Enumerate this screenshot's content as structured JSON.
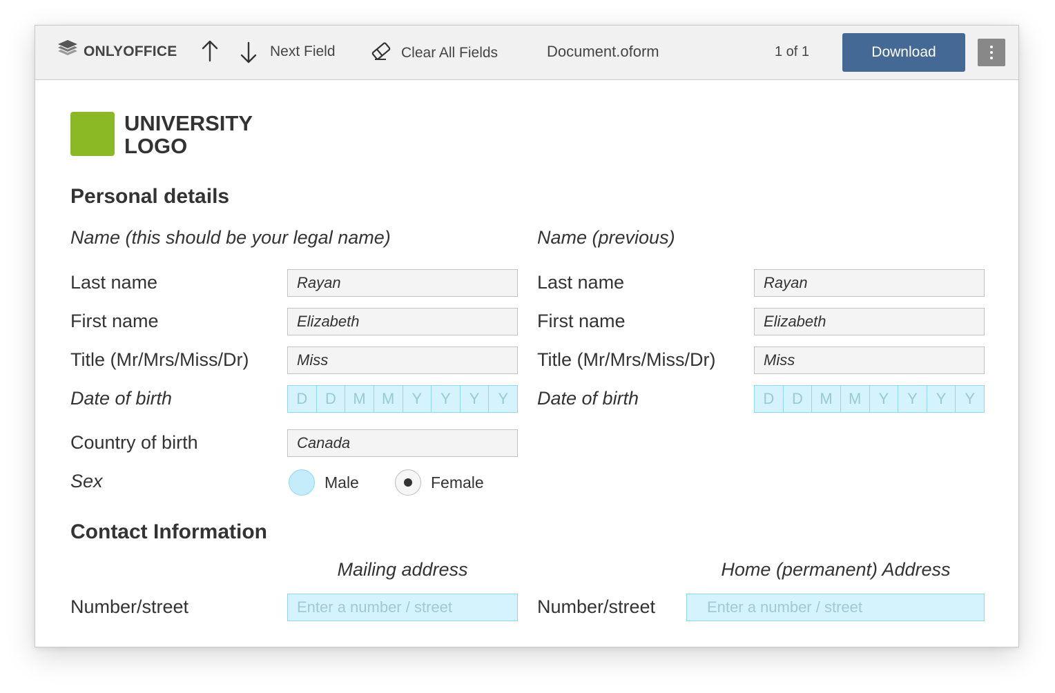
{
  "toolbar": {
    "logo_text": "ONLYOFFICE",
    "next_field_label": "Next Field",
    "clear_all_label": "Clear All Fields",
    "document_name": "Document.oform",
    "page_indicator": "1 of 1",
    "download_label": "Download"
  },
  "document": {
    "university_logo": {
      "line1": "UNIVERSITY",
      "line2": "LOGO"
    },
    "personal_details": {
      "heading": "Personal details",
      "legal_name_heading": "Name (this should be your legal name)",
      "previous_name_heading": "Name (previous)",
      "labels": {
        "last_name": "Last name",
        "first_name": "First name",
        "title": "Title (Mr/Mrs/Miss/Dr)",
        "date_of_birth": "Date of birth",
        "country_of_birth": "Country of birth",
        "sex": "Sex"
      },
      "legal": {
        "last_name": "Rayan",
        "first_name": "Elizabeth",
        "title": "Miss",
        "country_of_birth": "Canada"
      },
      "previous": {
        "last_name": "Rayan",
        "first_name": "Elizabeth",
        "title": "Miss"
      },
      "dob_placeholder": [
        "D",
        "D",
        "M",
        "M",
        "Y",
        "Y",
        "Y",
        "Y"
      ],
      "sex_options": {
        "male": "Male",
        "female": "Female",
        "selected": "Female"
      }
    },
    "contact": {
      "heading": "Contact Information",
      "mailing_heading": "Mailing address",
      "home_heading": "Home (permanent) Address",
      "number_street_label": "Number/street",
      "number_street_placeholder": "Enter a number / street"
    }
  },
  "colors": {
    "accent_blue": "#446995",
    "logo_green": "#8ab925",
    "field_highlight": "#d5f3fc"
  }
}
